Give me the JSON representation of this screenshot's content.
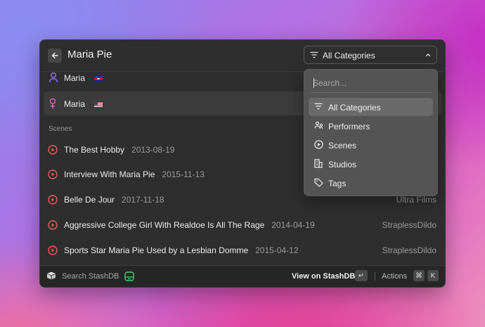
{
  "header": {
    "title": "Maria Pie",
    "category_select": "All Categories"
  },
  "performers": [
    {
      "name": "Maria",
      "flag": "KH"
    },
    {
      "name": "Maria",
      "flag": "US"
    }
  ],
  "scenes_section": "Scenes",
  "scenes": [
    {
      "title": "The Best Hobby",
      "date": "2013-08-19",
      "studio": ""
    },
    {
      "title": "Interview With Maria Pie",
      "date": "2015-11-13",
      "studio": ""
    },
    {
      "title": "Belle De Jour",
      "date": "2017-11-18",
      "studio": "Ultra Films"
    },
    {
      "title": "Aggressive College Girl With Realdoe Is All The Rage",
      "date": "2014-04-19",
      "studio": "StraplessDildo"
    },
    {
      "title": "Sports Star Maria Pie Used by a Lesbian Domme",
      "date": "2015-04-12",
      "studio": "StraplessDildo"
    }
  ],
  "dropdown": {
    "placeholder": "Search...",
    "items": [
      {
        "label": "All Categories",
        "icon": "filter-icon",
        "selected": true
      },
      {
        "label": "Performers",
        "icon": "performers-icon"
      },
      {
        "label": "Scenes",
        "icon": "play-circle-icon"
      },
      {
        "label": "Studios",
        "icon": "building-icon"
      },
      {
        "label": "Tags",
        "icon": "tag-icon"
      }
    ]
  },
  "footer": {
    "search_label": "Search StashDB",
    "view_label": "View on StashDB",
    "enter_key": "↵",
    "actions_label": "Actions",
    "cmd_key": "⌘",
    "k_key": "K"
  },
  "colors": {
    "accent_red": "#e35d5d",
    "performer_male": "#8a6cf0",
    "performer_female": "#d65fc4",
    "stash_green": "#3ccf7a"
  }
}
